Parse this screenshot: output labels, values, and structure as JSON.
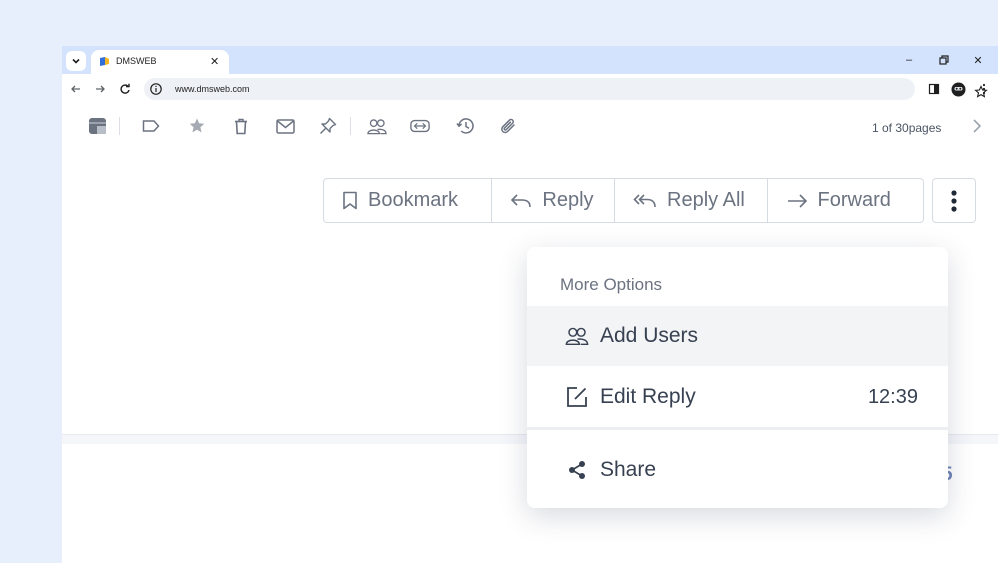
{
  "browser": {
    "tab_title": "DMSWEB",
    "url": "www.dmsweb.com",
    "icons": {
      "tab_list": "chevron-down-icon",
      "close_tab": "close-icon",
      "minimize": "minimize-icon",
      "restore": "restore-icon",
      "close_window": "close-icon",
      "back": "arrow-left-icon",
      "forward": "arrow-right-icon",
      "reload": "reload-icon",
      "site_info": "info-icon",
      "bookmark_star": "star-outline-icon",
      "side_panel": "side-panel-icon",
      "profile": "avatar",
      "menu": "more-vertical-icon"
    },
    "tab_close_glyph": "✕",
    "minimize_glyph": "–",
    "close_glyph": "✕"
  },
  "mail_toolbar": {
    "icons": [
      "archive-icon",
      "tag-icon",
      "star-icon",
      "trash-icon",
      "envelope-icon",
      "pin-icon",
      "users-icon",
      "transfer-icon",
      "history-icon",
      "paperclip-icon"
    ],
    "pager_text": "1 of 30pages",
    "next_icon": "chevron-right-icon"
  },
  "actions": {
    "bookmark": "Bookmark",
    "reply": "Reply",
    "reply_all": "Reply All",
    "forward": "Forward",
    "more_icon": "more-vertical-icon"
  },
  "background_fragment": "5",
  "dropdown": {
    "header": "More Options",
    "items": [
      {
        "label": "Add Users",
        "icon": "users-icon"
      },
      {
        "label": "Edit Reply",
        "icon": "edit-icon",
        "time": "12:39"
      },
      {
        "label": "Share",
        "icon": "share-icon"
      }
    ]
  },
  "colors": {
    "page_bg": "#e8effc",
    "tabstrip_bg": "#d3e3fd",
    "icon_gray": "#6b7280",
    "accent_blue": "#6e84b8"
  }
}
